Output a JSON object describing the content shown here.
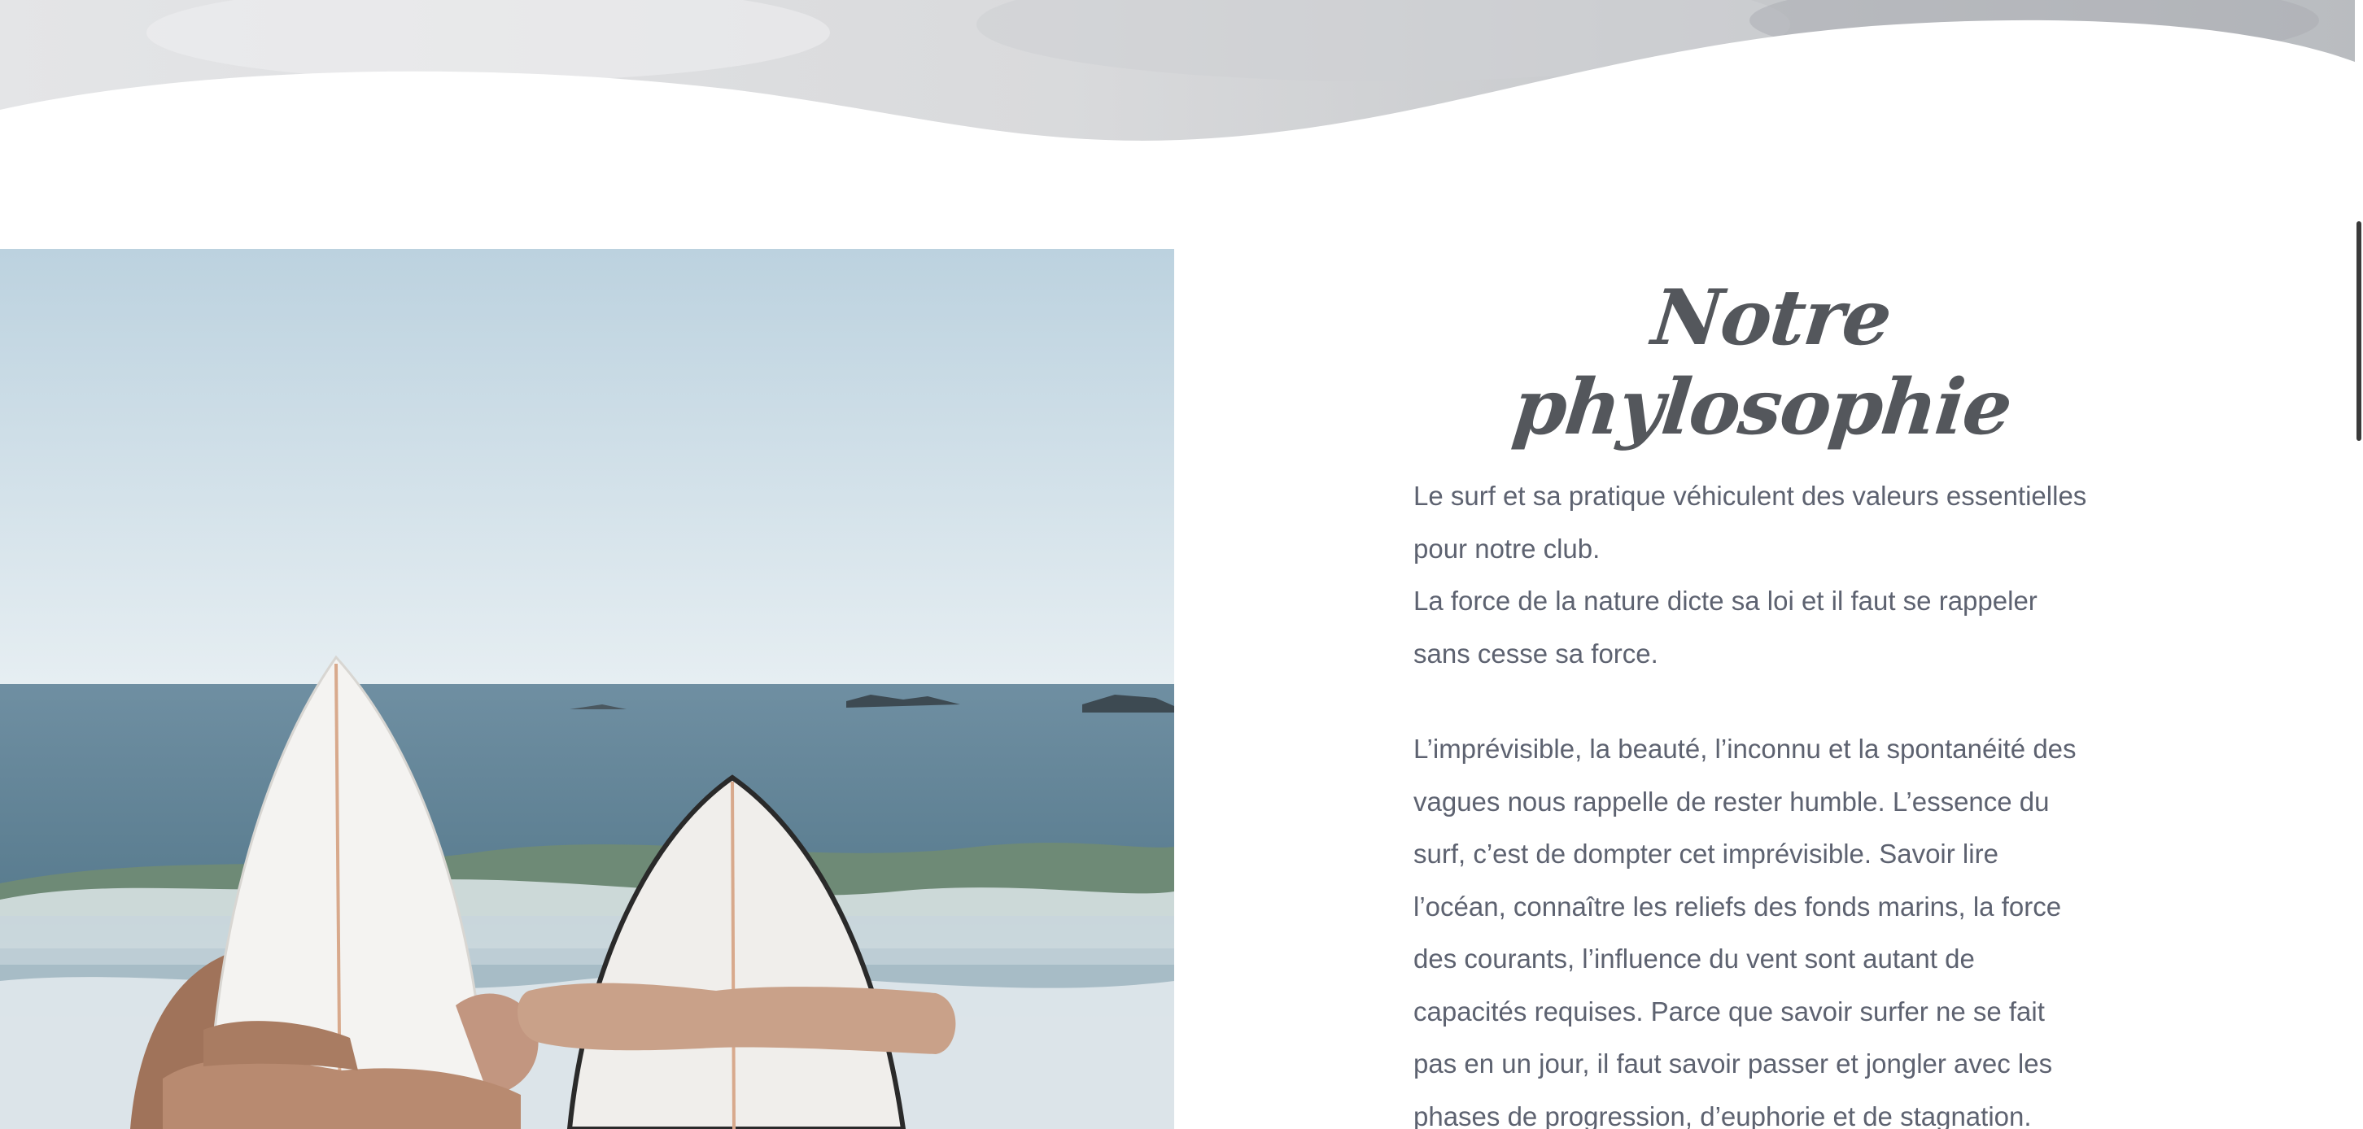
{
  "section": {
    "heading": "Notre phylosophie",
    "paragraph_1_lines": [
      "Le surf et sa pratique véhiculent des valeurs essentielles",
      "pour notre club.",
      "La force de la nature dicte sa loi et il faut se rappeler",
      "sans cesse sa force."
    ],
    "paragraph_2_lines": [
      "L’imprévisible, la beauté, l’inconnu et la spontanéité des",
      "vagues nous rappelle de rester humble. L’essence du",
      "surf, c’est de dompter cet imprévisible. Savoir lire",
      "l’océan, connaître les reliefs des fonds marins, la force",
      "des courants, l’influence du vent sont autant de",
      "capacités requises. Parce que savoir surfer ne se fait",
      "pas en un jour, il faut savoir passer et jongler avec les",
      "phases de progression, d’euphorie et de stagnation."
    ]
  },
  "colors": {
    "heading": "#54575c",
    "body_text": "#5d6270",
    "background": "#ffffff",
    "sky": "#c9dde9",
    "sea": "#5f8296"
  }
}
